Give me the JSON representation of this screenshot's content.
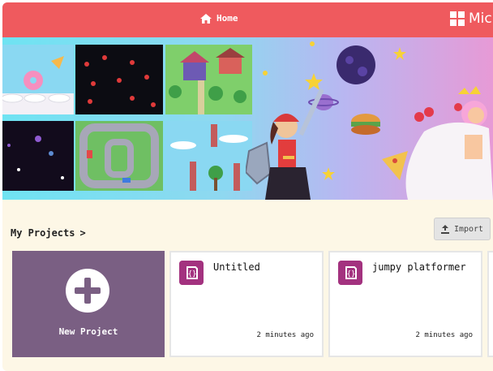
{
  "header": {
    "home_label": "Home",
    "brand_label": "Micro"
  },
  "hero": {
    "tiles": [
      "food-platformer-thumb",
      "cherry-space-thumb",
      "village-rpg-thumb",
      "space-thumb",
      "race-track-thumb",
      "sky-platformer-thumb"
    ]
  },
  "projects": {
    "section_title": "My Projects",
    "chevron": ">",
    "import_label": "Import",
    "new_project_label": "New Project",
    "cards": [
      {
        "title": "Untitled",
        "time": "2 minutes ago"
      },
      {
        "title": "jumpy platformer",
        "time": "2 minutes ago"
      }
    ]
  },
  "colors": {
    "header": "#ef5a5e",
    "new_project_card": "#7a5f83",
    "project_icon": "#a3327f",
    "page_background": "#fdf7e6"
  }
}
